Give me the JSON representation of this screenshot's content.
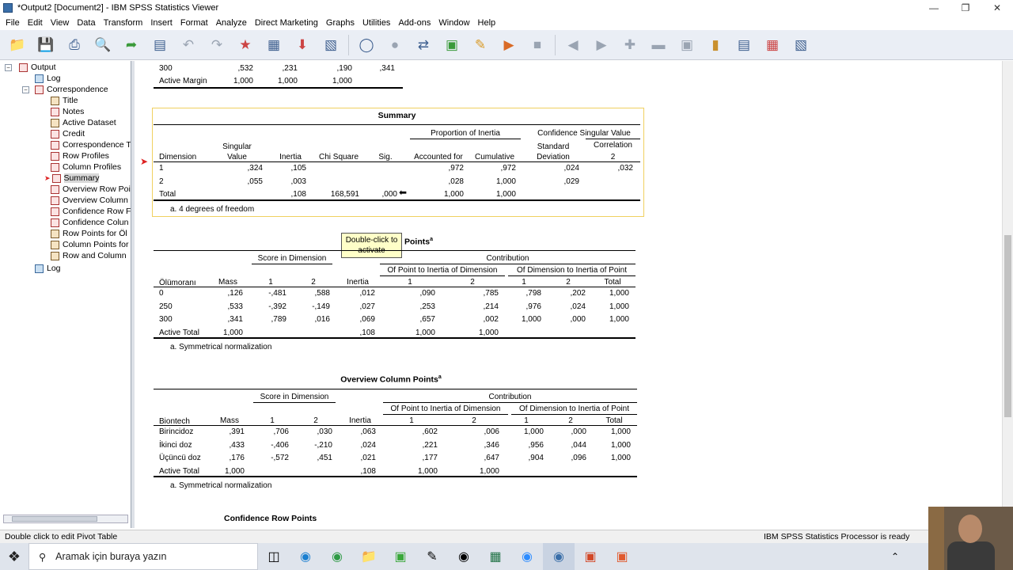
{
  "window": {
    "title": "*Output2 [Document2] - IBM SPSS Statistics Viewer"
  },
  "menu": [
    "File",
    "Edit",
    "View",
    "Data",
    "Transform",
    "Insert",
    "Format",
    "Analyze",
    "Direct Marketing",
    "Graphs",
    "Utilities",
    "Add-ons",
    "Window",
    "Help"
  ],
  "outline": {
    "output": "Output",
    "log1": "Log",
    "correspondence": "Correspondence",
    "items": [
      "Title",
      "Notes",
      "Active Dataset",
      "Credit",
      "Correspondence T",
      "Row Profiles",
      "Column Profiles",
      "Summary",
      "Overview Row Poi",
      "Overview Column",
      "Confidence Row F",
      "Confidence Colun",
      "Row Points for Öl",
      "Column Points for",
      "Row and Column"
    ],
    "log2": "Log"
  },
  "top_table": {
    "row300": [
      "300",
      ",532",
      ",231",
      ",190",
      ",341"
    ],
    "active_margin": [
      "Active Margin",
      "1,000",
      "1,000",
      "1,000"
    ]
  },
  "summary": {
    "title": "Summary",
    "h_proportion": "Proportion of Inertia",
    "h_confidence": "Confidence Singular Value",
    "h_correlation": "Correlation",
    "h_dimension": "Dimension",
    "h_singular": "Singular",
    "h_value": "Value",
    "h_inertia": "Inertia",
    "h_chi": "Chi Square",
    "h_sig": "Sig.",
    "h_accounted": "Accounted for",
    "h_cumulative": "Cumulative",
    "h_standard": "Standard",
    "h_deviation": "Deviation",
    "h_two": "2",
    "rows": [
      {
        "dim": "1",
        "sv": ",324",
        "inertia": ",105",
        "chi": "",
        "sig": "",
        "acc": ",972",
        "cum": ",972",
        "sd": ",024",
        "corr": ",032"
      },
      {
        "dim": "2",
        "sv": ",055",
        "inertia": ",003",
        "chi": "",
        "sig": "",
        "acc": ",028",
        "cum": "1,000",
        "sd": ",029",
        "corr": ""
      },
      {
        "dim": "Total",
        "sv": "",
        "inertia": ",108",
        "chi": "168,591",
        "sig": ",000",
        "acc": "1,000",
        "cum": "1,000",
        "sd": "",
        "corr": ""
      }
    ],
    "footnote": "a. 4 degrees of freedom"
  },
  "tooltip": {
    "line1": "Double-click to",
    "line2": "activate"
  },
  "row_points": {
    "title_visible": "Points",
    "sup": "a",
    "h_score": "Score in Dimension",
    "h_contribution": "Contribution",
    "h_point_to_inertia": "Of Point to Inertia of Dimension",
    "h_dim_to_inertia": "Of Dimension to Inertia of Point",
    "h_first": "Ölümoranı",
    "h_mass": "Mass",
    "h_1": "1",
    "h_2": "2",
    "h_inertia": "Inertia",
    "h_total": "Total",
    "rows": [
      [
        "0",
        ",126",
        "-,481",
        ",588",
        ",012",
        ",090",
        ",785",
        ",798",
        ",202",
        "1,000"
      ],
      [
        "250",
        ",533",
        "-,392",
        "-,149",
        ",027",
        ",253",
        ",214",
        ",976",
        ",024",
        "1,000"
      ],
      [
        "300",
        ",341",
        ",789",
        ",016",
        ",069",
        ",657",
        ",002",
        "1,000",
        ",000",
        "1,000"
      ],
      [
        "Active Total",
        "1,000",
        "",
        "",
        ",108",
        "1,000",
        "1,000",
        "",
        "",
        ""
      ]
    ],
    "footnote": "a. Symmetrical normalization"
  },
  "col_points": {
    "title": "Overview Column Points",
    "sup": "a",
    "h_first": "Biontech",
    "rows": [
      [
        "Birincidoz",
        ",391",
        ",706",
        ",030",
        ",063",
        ",602",
        ",006",
        "1,000",
        ",000",
        "1,000"
      ],
      [
        "İkinci doz",
        ",433",
        "-,406",
        "-,210",
        ",024",
        ",221",
        ",346",
        ",956",
        ",044",
        "1,000"
      ],
      [
        "Üçüncü doz",
        ",176",
        "-,572",
        ",451",
        ",021",
        ",177",
        ",647",
        ",904",
        ",096",
        "1,000"
      ],
      [
        "Active Total",
        "1,000",
        "",
        "",
        ",108",
        "1,000",
        "1,000",
        "",
        "",
        ""
      ]
    ],
    "footnote": "a. Symmetrical normalization"
  },
  "next_title": "Confidence Row Points",
  "status": {
    "left": "Double click to edit Pivot Table",
    "right": "IBM SPSS Statistics Processor is ready"
  },
  "taskbar": {
    "search_placeholder": "Aramak için buraya yazın"
  }
}
